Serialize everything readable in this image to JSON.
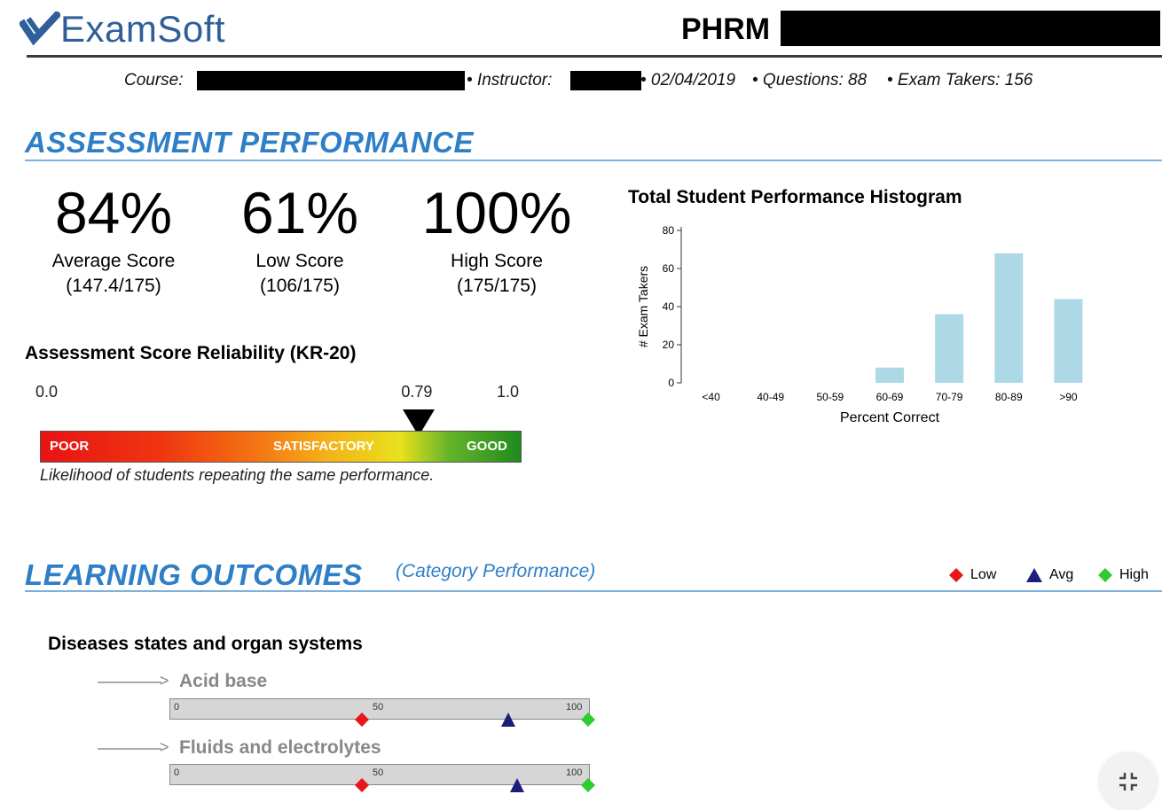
{
  "header": {
    "logo_text": "ExamSoft",
    "exam_title_prefix": "PHRM"
  },
  "meta": {
    "course_label": "Course:",
    "instructor_label": "• Instructor:",
    "date": "• 02/04/2019",
    "questions": "• Questions: 88",
    "exam_takers": "• Exam Takers: 156"
  },
  "assessment": {
    "section_title": "ASSESSMENT PERFORMANCE",
    "stats": [
      {
        "value": "84%",
        "label": "Average Score",
        "sub": "(147.4/175)"
      },
      {
        "value": "61%",
        "label": "Low Score",
        "sub": "(106/175)"
      },
      {
        "value": "100%",
        "label": "High Score",
        "sub": "(175/175)"
      }
    ]
  },
  "reliability": {
    "title": "Assessment Score Reliability (KR-20)",
    "min_label": "0.0",
    "value_label": "0.79",
    "max_label": "1.0",
    "value": 0.79,
    "zones": {
      "poor": "POOR",
      "satisfactory": "SATISFACTORY",
      "good": "GOOD"
    },
    "caption": "Likelihood of students repeating the same performance."
  },
  "chart_data": {
    "type": "bar",
    "title": "Total Student Performance Histogram",
    "xlabel": "Percent Correct",
    "ylabel": "# Exam Takers",
    "categories": [
      "<40",
      "40-49",
      "50-59",
      "60-69",
      "70-79",
      "80-89",
      ">90"
    ],
    "values": [
      0,
      0,
      0,
      8,
      36,
      68,
      44
    ],
    "ylim": [
      0,
      80
    ],
    "yticks": [
      0,
      20,
      40,
      60,
      80
    ],
    "bar_color": "#add8e6",
    "grid": false
  },
  "learning_outcomes": {
    "section_title": "LEARNING OUTCOMES",
    "subtitle": "(Category Performance)",
    "legend": [
      {
        "label": "Low",
        "color": "#e8161b",
        "shape": "diamond"
      },
      {
        "label": "Avg",
        "color": "#1c1f7a",
        "shape": "triangle"
      },
      {
        "label": "High",
        "color": "#2ecc2e",
        "shape": "diamond"
      }
    ],
    "category_heading": "Diseases states and organ systems",
    "scale_labels": [
      "0",
      "50",
      "100"
    ],
    "outcomes": [
      {
        "name": "Acid base",
        "low": 46,
        "avg": 81,
        "high": 100
      },
      {
        "name": "Fluids and electrolytes",
        "low": 46,
        "avg": 83,
        "high": 100
      }
    ]
  },
  "colors": {
    "accent_blue": "#2f7fc8",
    "logo_blue": "#2f5f98"
  }
}
